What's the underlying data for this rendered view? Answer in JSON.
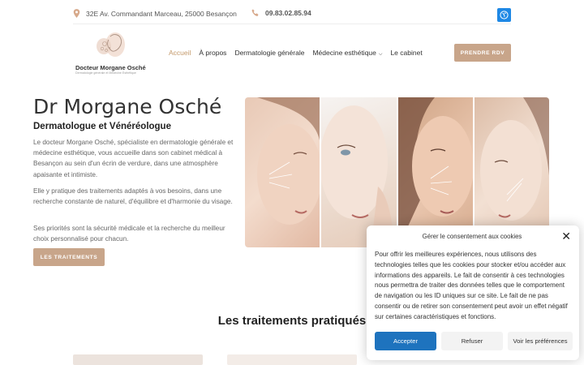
{
  "topbar": {
    "address": "32E Av. Commandant Marceau, 25000 Besançon",
    "phone": "09.83.02.85.94",
    "address_icon": "map-pin-icon",
    "phone_icon": "phone-icon",
    "accessibility_icon": "accessibility-icon"
  },
  "logo": {
    "name": "Docteur Morgane Osché",
    "tagline": "Dermatologie générale et Médecine Esthétique"
  },
  "nav": {
    "items": [
      "Accueil",
      "À propos",
      "Dermatologie générale",
      "Médecine esthétique",
      "Le cabinet"
    ],
    "active": "Accueil",
    "cta": "PRENDRE RDV"
  },
  "hero": {
    "title": "Dr Morgane Osché",
    "subtitle": "Dermatologue et Vénéréologue",
    "paragraph1": "Le docteur Morgane Osché, spécialiste en dermatologie générale et médecine esthétique, vous accueille dans son cabinet médical à Besançon au sein d'un écrin de verdure, dans une atmosphère apaisante et intimiste.",
    "paragraph2": "Elle y pratique des traitements adaptés à vos besoins, dans une recherche constante de naturel, d'équilibre et d'harmonie du visage.",
    "paragraph3": "Ses priorités sont la sécurité médicale et la recherche du meilleur choix personnalisé pour chacun.",
    "button": "LES TRAITEMENTS"
  },
  "section": {
    "title": "Les traitements pratiqués"
  },
  "consent": {
    "title": "Gérer le consentement aux cookies",
    "body": "Pour offrir les meilleures expériences, nous utilisons des technologies telles que les cookies pour stocker et/ou accéder aux informations des appareils. Le fait de consentir à ces technologies nous permettra de traiter des données telles que le comportement de navigation ou les ID uniques sur ce site. Le fait de ne pas consentir ou de retirer son consentement peut avoir un effet négatif sur certaines caractéristiques et fonctions.",
    "accept": "Accepter",
    "refuse": "Refuser",
    "preferences": "Voir les préférences"
  },
  "colors": {
    "accent": "#c8a58a",
    "active_nav": "#c49a6c",
    "consent_primary": "#1e73be",
    "accessibility": "#1e88e5"
  }
}
